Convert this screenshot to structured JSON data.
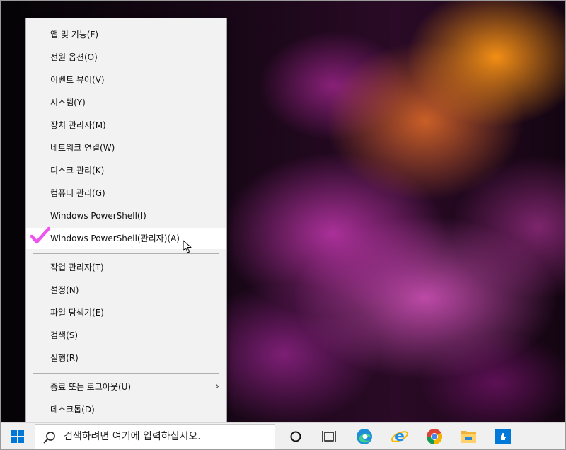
{
  "menu": {
    "items": [
      {
        "label": "앱 및 기능(F)"
      },
      {
        "label": "전원 옵션(O)"
      },
      {
        "label": "이벤트 뷰어(V)"
      },
      {
        "label": "시스템(Y)"
      },
      {
        "label": "장치 관리자(M)"
      },
      {
        "label": "네트워크 연결(W)"
      },
      {
        "label": "디스크 관리(K)"
      },
      {
        "label": "컴퓨터 관리(G)"
      },
      {
        "label": "Windows PowerShell(I)"
      },
      {
        "label": "Windows PowerShell(관리자)(A)"
      },
      {
        "label": "작업 관리자(T)"
      },
      {
        "label": "설정(N)"
      },
      {
        "label": "파일 탐색기(E)"
      },
      {
        "label": "검색(S)"
      },
      {
        "label": "실행(R)"
      },
      {
        "label": "종료 또는 로그아웃(U)"
      },
      {
        "label": "데스크톱(D)"
      }
    ],
    "highlighted_item": "Windows PowerShell(관리자)(A)",
    "check_color": "#ee55ee"
  },
  "taskbar": {
    "search_placeholder": "검색하려면 여기에 입력하십시오.",
    "icons": [
      "windows-start-icon",
      "search-icon",
      "cortana-icon",
      "task-view-icon",
      "edge-icon",
      "internet-explorer-icon",
      "chrome-icon",
      "file-explorer-icon",
      "store-app-icon"
    ],
    "accent": "#0078d7"
  }
}
